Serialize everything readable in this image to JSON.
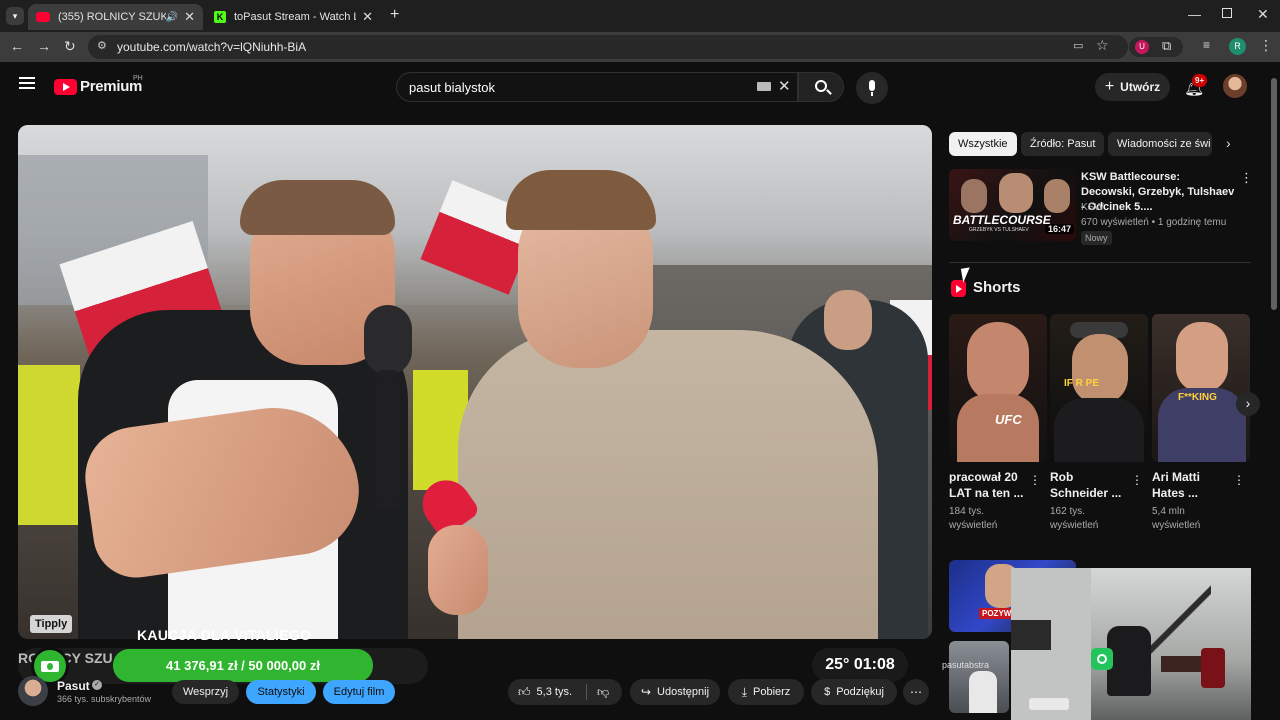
{
  "browser": {
    "tabs": [
      {
        "title": "(355) ROLNICY SZUKAJĄ ŻO",
        "active": true
      },
      {
        "title": "toPasut Stream - Watch Live on",
        "active": false
      }
    ],
    "url": "youtube.com/watch?v=lQNiuhh-BiA",
    "profile_initial": "R"
  },
  "youtube": {
    "logo_text": "Premium",
    "region": "PH",
    "search_query": "pasut bialystok",
    "create_label": "Utwórz",
    "notifications": "9+"
  },
  "overlay": {
    "tipply": "Tipply",
    "goal_title": "KAUCJA DLA VITALIEGO",
    "goal_amount": "41 376,91 zł / 50 000,00 zł",
    "weather": "25° 01:08",
    "video_title_peek": "ROLNICY SZU"
  },
  "channel": {
    "name": "Pasut",
    "subscribers": "366 tys. subskrybentów",
    "buttons": [
      "Wesprzyj",
      "Statystyki",
      "Edytuj film"
    ]
  },
  "actions": {
    "likes": "5,3 tys.",
    "share": "Udostępnij",
    "download": "Pobierz",
    "thanks": "Podziękuj"
  },
  "chips": [
    "Wszystkie",
    "Źródło: Pasut",
    "Wiadomości ze świ"
  ],
  "related": {
    "title": "KSW Battlecourse: Decowski, Grzebyk, Tulshaev - Odcinek 5....",
    "channel": "KSW",
    "meta": "670 wyświetleń • 1 godzinę temu",
    "badge": "Nowy",
    "duration": "16:47",
    "thumb_text": "BATTLECOURSE",
    "thumb_sub": "GRZEBYK VS TULSHAEV"
  },
  "shorts": {
    "heading": "Shorts",
    "items": [
      {
        "title": "pracował 20 LAT na ten ...",
        "views": "184 tys. wyświetleń",
        "overlay": "UFC"
      },
      {
        "title": "Rob Schneider ...",
        "views": "162 tys. wyświetleń",
        "overlay": "IF R PE"
      },
      {
        "title": "Ari Matti Hates ...",
        "views": "5,4 mln wyświetleń",
        "overlay": "F**KING"
      }
    ]
  },
  "bottom": {
    "thumb_text": "POZYWA",
    "webcam_label": "pasutabstra"
  },
  "colors": {
    "accent_red": "#ff0033",
    "goal_green": "#2fb52f",
    "link_blue": "#3ea6ff"
  }
}
